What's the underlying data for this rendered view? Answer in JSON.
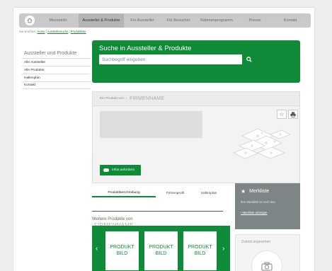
{
  "nav": {
    "home_icon": "home-icon",
    "items": [
      {
        "label": "Messeinfo"
      },
      {
        "label": "Aussteller & Produkte"
      },
      {
        "label": "Für Aussteller"
      },
      {
        "label": "Für Besucher"
      },
      {
        "label": "Rahmenprogramm"
      },
      {
        "label": "Presse"
      },
      {
        "label": "Kontakt"
      }
    ],
    "active_index": 1
  },
  "breadcrumb": {
    "prefix": "Sie sind hier:",
    "items": [
      "Home",
      "Ausstellersuche",
      "Produktliste"
    ]
  },
  "sidebar": {
    "title": "Aussteller und Produkte",
    "items": [
      {
        "label": "Alle Aussteller"
      },
      {
        "label": "Alle Produkte"
      },
      {
        "label": "Hallenplan"
      },
      {
        "label": "Kontakt"
      }
    ]
  },
  "search": {
    "title": "Suche in Aussteller & Produkte",
    "placeholder": "Suchbegriff eingeben",
    "icon": "search-icon"
  },
  "product_card": {
    "prefix": "Ein Produkt von: ›",
    "company": "FIRMENNAME",
    "star_icon": "star-icon",
    "print_icon": "print-icon",
    "info_button": "Infos anfordern"
  },
  "tabs": {
    "items": [
      "Produktbeschreibung",
      "Firmenprofil",
      "Hallenplan"
    ],
    "active_index": 0
  },
  "merkliste": {
    "title": "Merkliste",
    "text": "Ihre Merkliste ist noch leer.",
    "link": "› Merkliste anzeigen"
  },
  "more_products": {
    "title": "Weitere Produkte von",
    "company": "›FIRMENNAME",
    "products": [
      {
        "line1": "PRODUKT",
        "line2": "BILD"
      },
      {
        "line1": "PRODUKT",
        "line2": "BILD"
      },
      {
        "line1": "PRODUKT",
        "line2": "BILD"
      }
    ]
  },
  "recently_viewed": {
    "title": "Zuletzt angesehen",
    "icon": "camera-icon"
  },
  "colors": {
    "accent": "#0e8a39",
    "nav_bg": "#c9c9c9",
    "merkliste_bg": "#7e8587"
  }
}
